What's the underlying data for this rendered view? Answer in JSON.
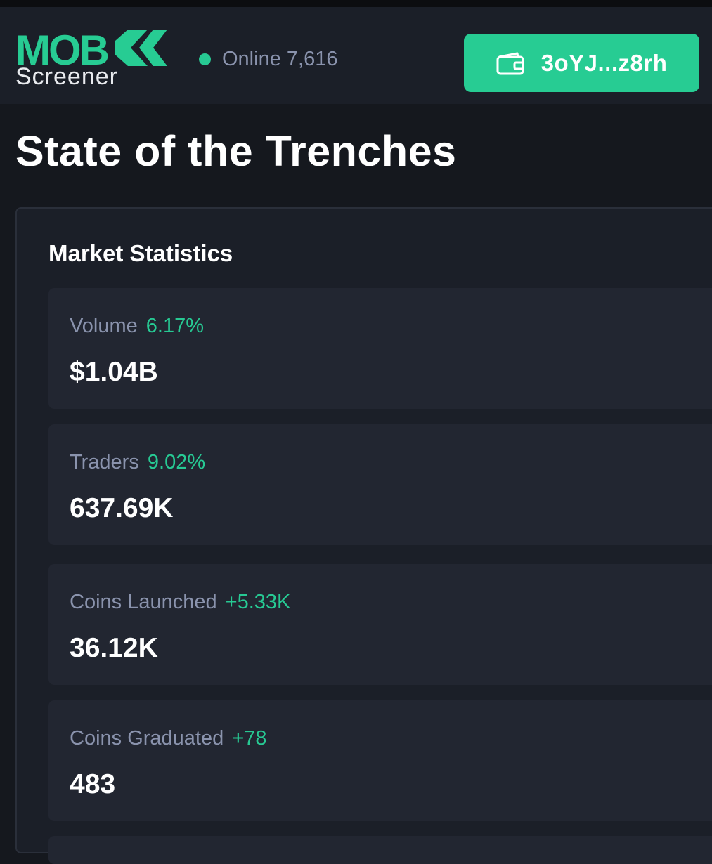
{
  "header": {
    "logo_text": "MOB",
    "logo_subtitle": "Screener",
    "online_label": "Online 7,616",
    "wallet": {
      "label": "3oYJ...z8rh",
      "icon": "wallet-icon"
    }
  },
  "page": {
    "title": "State of the Trenches"
  },
  "market_statistics": {
    "title": "Market Statistics",
    "items": [
      {
        "label": "Volume",
        "change": "6.17%",
        "value": "$1.04B"
      },
      {
        "label": "Traders",
        "change": "9.02%",
        "value": "637.69K"
      },
      {
        "label": "Coins Launched",
        "change": "+5.33K",
        "value": "36.12K"
      },
      {
        "label": "Coins Graduated",
        "change": "+78",
        "value": "483"
      }
    ]
  },
  "colors": {
    "accent": "#27cc93",
    "background": "#15181e",
    "panel": "#1b1f28",
    "tile": "#222631",
    "muted_text": "#8a93ad"
  }
}
